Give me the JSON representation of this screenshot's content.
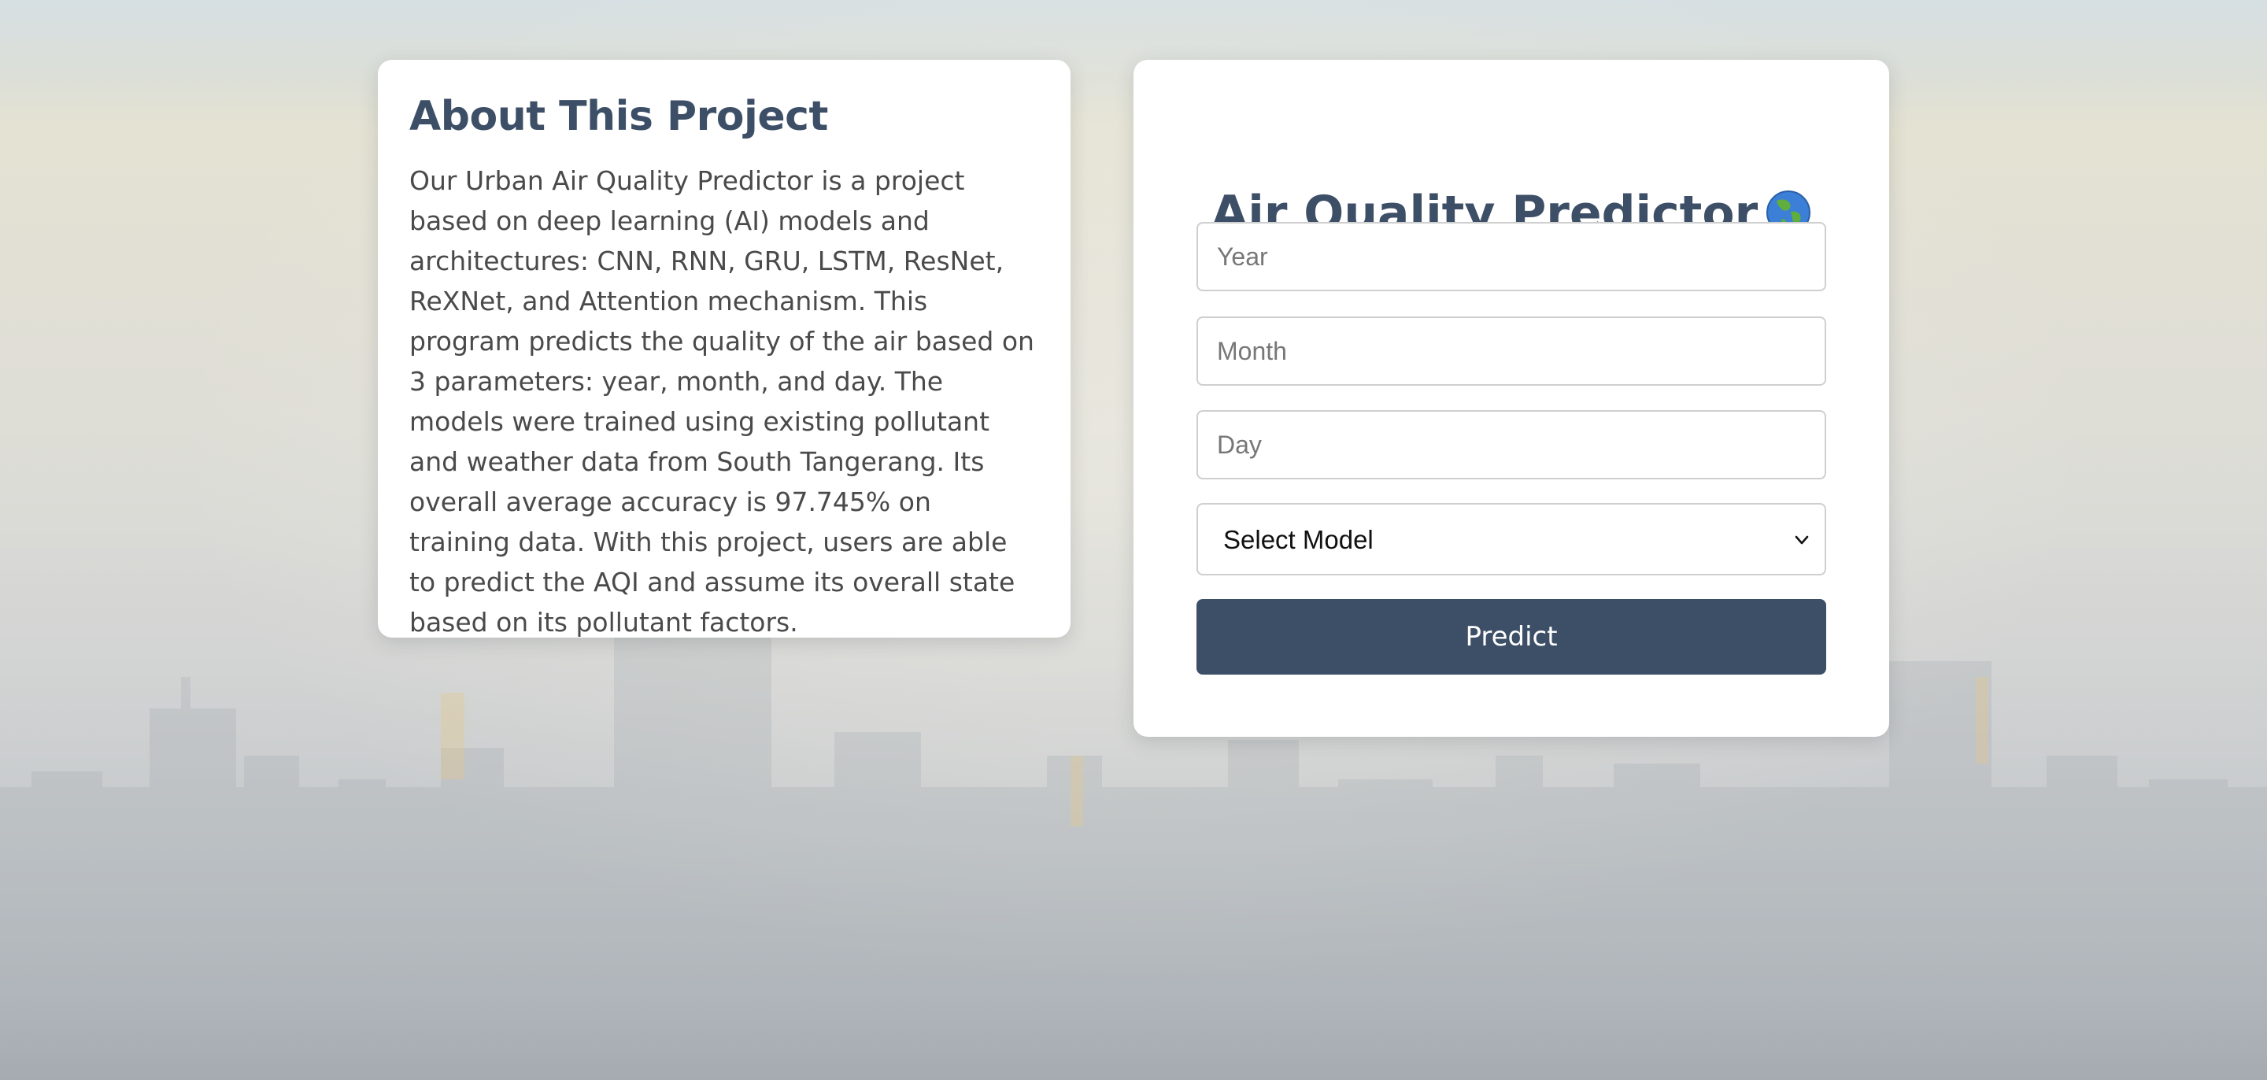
{
  "about": {
    "title": "About This Project",
    "text": "Our Urban Air Quality Predictor is a project based on deep learning (AI) models and architectures: CNN, RNN, GRU, LSTM, ResNet, ReXNet, and Attention mechanism. This program predicts the quality of the air based on 3 parameters: year, month, and day. The models were trained using existing pollutant and weather data from South Tangerang. Its overall average accuracy is 97.745% on training data. With this project, users are able to predict the AQI and assume its overall state based on its pollutant factors."
  },
  "form": {
    "title": "Air Quality Predictor",
    "title_icon": "globe-asia-icon",
    "year_placeholder": "Year",
    "month_placeholder": "Month",
    "day_placeholder": "Day",
    "model_select_value": "Select Model",
    "predict_label": "Predict"
  },
  "colors": {
    "primary": "#3d4f67",
    "card_background": "#ffffff",
    "body_text": "#4a4a4a"
  }
}
